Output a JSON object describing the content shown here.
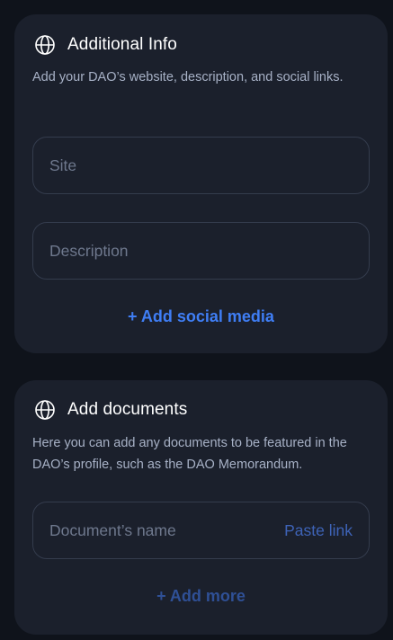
{
  "additional_info": {
    "title": "Additional Info",
    "icon": "globe-icon",
    "description": "Add your DAO’s website, description, and social links.",
    "site_field": {
      "placeholder": "Site",
      "value": ""
    },
    "description_field": {
      "placeholder": "Description",
      "value": ""
    },
    "add_social_label": "+ Add social media"
  },
  "add_documents": {
    "title": "Add documents",
    "icon": "globe-icon",
    "description": "Here you can add any documents to be featured in the DAO’s profile, such as the DAO Memorandum.",
    "document_field": {
      "placeholder": "Document’s name",
      "value": ""
    },
    "paste_link_label": "Paste link",
    "add_more_label": "+ Add more"
  },
  "colors": {
    "page_background": "#0f131b",
    "card_background": "#1b202c",
    "accent": "#3f7ef5",
    "accent_muted": "#2f5096",
    "field_border": "#343c4d"
  }
}
